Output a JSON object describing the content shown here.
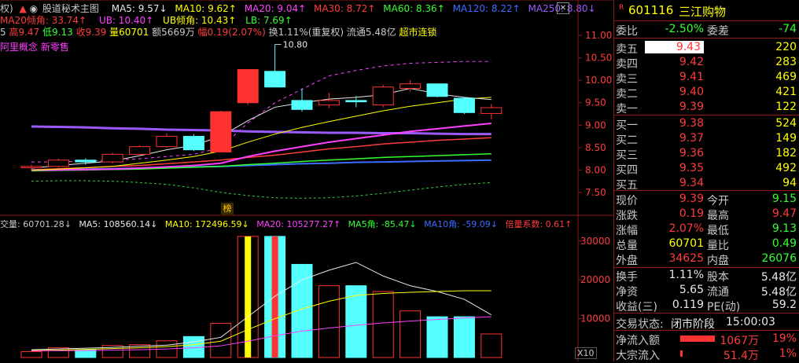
{
  "top_bar": {
    "left_label": "权)",
    "title": "股道秘术主图",
    "ma5": "MA5: 9.57↓",
    "ma10": "MA10: 9.62↑",
    "ma20": "MA20: 9.04↑",
    "ma30": "MA30: 8.72↑",
    "ma60": "MA60: 8.36↑",
    "ma120": "MA120: 8.22↑",
    "ma250": "MA250: 8.80↓"
  },
  "line2": {
    "ma20_angle": "MA20倾角: 33.74↑",
    "ub": "UB: 10.40↑",
    "ub_angle": "UB倾角: 10.43↑",
    "lb": "LB: 7.69↑"
  },
  "line3": {
    "prefix": "5",
    "high": "高9.47",
    "low": "低9.13",
    "close": "收9.39",
    "volume": "量60701",
    "amount": "额5669万",
    "amp": "幅0.19(2.07%)",
    "turnover": "换1.11%(重复权)",
    "float": "流通5.48亿",
    "tag": "超市连锁"
  },
  "concept": "阿里概念 新零售",
  "price_axis": [
    "11.00",
    "10.50",
    "10.00",
    "9.50",
    "9.00",
    "8.50",
    "8.00",
    "7.50"
  ],
  "high_marker": "10.80",
  "bang_label": "榜",
  "vol_bar": {
    "vol": "交量: 60701.28↓",
    "ma5": "MA5: 108560.14↓",
    "ma10": "MA10: 172496.59↓",
    "ma20": "MA20: 105277.27↑",
    "ma5_angle": "MA5角: -85.47↓",
    "ma10_angle": "MA10角: -59.09↓",
    "ratio": "倍量系数: 0.61↑"
  },
  "vol_axis": [
    "30000",
    "20000",
    "10000"
  ],
  "x10": "X10",
  "colors": {
    "up": "#ff3232",
    "down": "#54ffff",
    "ma5": "#e8e8e8",
    "ma10": "#ffff00",
    "ma20": "#ff40ff",
    "ma250": "#9b5bff",
    "border": "#8b1a1a"
  },
  "chart_data": {
    "type": "candlestick",
    "candles": [
      {
        "o": 8.05,
        "h": 8.12,
        "l": 7.98,
        "c": 8.08
      },
      {
        "o": 8.08,
        "h": 8.25,
        "l": 8.06,
        "c": 8.22
      },
      {
        "o": 8.22,
        "h": 8.26,
        "l": 8.12,
        "c": 8.18
      },
      {
        "o": 8.18,
        "h": 8.38,
        "l": 8.15,
        "c": 8.35
      },
      {
        "o": 8.35,
        "h": 8.55,
        "l": 8.32,
        "c": 8.52
      },
      {
        "o": 8.52,
        "h": 8.82,
        "l": 8.5,
        "c": 8.75
      },
      {
        "o": 8.75,
        "h": 8.8,
        "l": 8.42,
        "c": 8.45
      },
      {
        "o": 8.4,
        "h": 9.32,
        "l": 8.4,
        "c": 9.3
      },
      {
        "o": 9.5,
        "h": 10.25,
        "l": 9.45,
        "c": 10.24
      },
      {
        "o": 10.2,
        "h": 10.8,
        "l": 9.85,
        "c": 9.85
      },
      {
        "o": 9.55,
        "h": 9.82,
        "l": 9.3,
        "c": 9.35
      },
      {
        "o": 9.45,
        "h": 9.72,
        "l": 9.38,
        "c": 9.55
      },
      {
        "o": 9.55,
        "h": 9.65,
        "l": 9.4,
        "c": 9.52
      },
      {
        "o": 9.45,
        "h": 9.9,
        "l": 9.4,
        "c": 9.85
      },
      {
        "o": 9.82,
        "h": 10.0,
        "l": 9.75,
        "c": 9.92
      },
      {
        "o": 9.92,
        "h": 9.92,
        "l": 9.62,
        "c": 9.64
      },
      {
        "o": 9.6,
        "h": 9.63,
        "l": 9.25,
        "c": 9.28
      },
      {
        "o": 9.26,
        "h": 9.47,
        "l": 9.13,
        "c": 9.39
      }
    ],
    "volumes": [
      1500,
      2500,
      2000,
      3100,
      3300,
      4300,
      5400,
      8800,
      31200,
      31200,
      24000,
      18500,
      18500,
      17000,
      12000,
      10500,
      10500,
      6070
    ],
    "y_range": [
      7.2,
      11.3
    ],
    "vol_range": [
      0,
      33000
    ],
    "ma5": [
      8.04,
      8.1,
      8.15,
      8.2,
      8.32,
      8.45,
      8.55,
      8.75,
      9.1,
      9.4,
      9.5,
      9.58,
      9.62,
      9.68,
      9.82,
      9.7,
      9.62,
      9.57
    ],
    "ma10": [
      8.0,
      8.02,
      8.05,
      8.08,
      8.15,
      8.22,
      8.3,
      8.42,
      8.62,
      8.8,
      8.95,
      9.08,
      9.2,
      9.32,
      9.42,
      9.5,
      9.58,
      9.62
    ],
    "ma20": [
      8.0,
      8.0,
      8.01,
      8.02,
      8.04,
      8.07,
      8.1,
      8.15,
      8.3,
      8.42,
      8.52,
      8.62,
      8.7,
      8.78,
      8.86,
      8.92,
      8.98,
      9.04
    ],
    "ub_band": [
      8.18,
      8.18,
      8.2,
      8.22,
      8.25,
      8.3,
      8.35,
      8.5,
      9.05,
      9.5,
      9.8,
      10.1,
      10.22,
      10.32,
      10.38,
      10.4,
      10.42,
      10.42
    ],
    "lb_band": [
      7.75,
      7.76,
      7.76,
      7.75,
      7.72,
      7.68,
      7.6,
      7.5,
      7.43,
      7.38,
      7.37,
      7.38,
      7.42,
      7.48,
      7.55,
      7.62,
      7.68,
      7.72
    ],
    "ma250": [
      8.97,
      8.96,
      8.95,
      8.93,
      8.92,
      8.9,
      8.89,
      8.88,
      8.86,
      8.85,
      8.84,
      8.83,
      8.83,
      8.82,
      8.82,
      8.81,
      8.8,
      8.8
    ],
    "ma30": [
      8.0,
      8.03,
      8.05,
      8.08,
      8.1,
      8.14,
      8.18,
      8.22,
      8.28,
      8.33,
      8.4,
      8.47,
      8.52,
      8.58,
      8.62,
      8.66,
      8.69,
      8.72
    ],
    "ma60": [
      7.98,
      7.99,
      8.0,
      8.01,
      8.02,
      8.04,
      8.06,
      8.08,
      8.12,
      8.15,
      8.19,
      8.22,
      8.25,
      8.28,
      8.3,
      8.32,
      8.34,
      8.36
    ],
    "ma120": [
      8.0,
      8.01,
      8.02,
      8.03,
      8.04,
      8.05,
      8.07,
      8.08,
      8.1,
      8.12,
      8.14,
      8.15,
      8.17,
      8.18,
      8.19,
      8.2,
      8.21,
      8.22
    ],
    "vol_ma5": [
      2000,
      2200,
      2400,
      2600,
      2900,
      3200,
      4000,
      5200,
      10500,
      15800,
      20000,
      22500,
      24500,
      21000,
      18500,
      17000,
      15000,
      11000
    ],
    "vol_ma10": [
      1800,
      1900,
      2100,
      2300,
      2500,
      2800,
      3300,
      4200,
      7200,
      10000,
      12500,
      14500,
      16000,
      16500,
      16800,
      17000,
      17200,
      17200
    ],
    "vol_ma20": [
      1700,
      1750,
      1800,
      1900,
      2000,
      2200,
      2500,
      3000,
      4200,
      5600,
      6800,
      7600,
      8300,
      8900,
      9400,
      9800,
      10200,
      10500
    ]
  },
  "side": {
    "code": "601116",
    "name": "三江购物",
    "r_mark": "R",
    "weibi_label": "委比",
    "weibi": "-2.50%",
    "weicha_label": "委差",
    "weicha": "-74",
    "asks": [
      {
        "label": "卖五",
        "price": "9.43",
        "vol": "220"
      },
      {
        "label": "卖四",
        "price": "9.42",
        "vol": "283"
      },
      {
        "label": "卖三",
        "price": "9.41",
        "vol": "469"
      },
      {
        "label": "卖二",
        "price": "9.40",
        "vol": "421"
      },
      {
        "label": "卖一",
        "price": "9.39",
        "vol": "122"
      }
    ],
    "bids": [
      {
        "label": "买一",
        "price": "9.38",
        "vol": "524"
      },
      {
        "label": "买二",
        "price": "9.37",
        "vol": "149"
      },
      {
        "label": "买三",
        "price": "9.36",
        "vol": "182"
      },
      {
        "label": "买四",
        "price": "9.35",
        "vol": "492"
      },
      {
        "label": "买五",
        "price": "9.34",
        "vol": "94"
      }
    ],
    "quote": [
      {
        "l1": "现价",
        "v1": "9.39",
        "l2": "今开",
        "v2": "9.15",
        "c1": "red",
        "c2": "green"
      },
      {
        "l1": "涨跌",
        "v1": "0.19",
        "l2": "最高",
        "v2": "9.47",
        "c1": "red",
        "c2": "red"
      },
      {
        "l1": "涨幅",
        "v1": "2.07%",
        "l2": "最低",
        "v2": "9.13",
        "c1": "red",
        "c2": "green"
      },
      {
        "l1": "总量",
        "v1": "60701",
        "l2": "量比",
        "v2": "0.49",
        "c1": "yellow",
        "c2": "green"
      },
      {
        "l1": "外盘",
        "v1": "34625",
        "l2": "内盘",
        "v2": "26076",
        "c1": "red",
        "c2": "green"
      }
    ],
    "fund": [
      {
        "l1": "换手",
        "v1": "1.11%",
        "l2": "股本",
        "v2": "5.48亿"
      },
      {
        "l1": "净资",
        "v1": "5.65",
        "l2": "流通",
        "v2": "5.48亿"
      },
      {
        "l1": "收益(三)",
        "v1": "0.119",
        "l2": "PE(动)",
        "v2": "59.2"
      }
    ],
    "trade_state_label": "交易状态:",
    "trade_state": "闭市阶段",
    "trade_time": "15:00:03",
    "netflow_label": "净流入额",
    "netflow_value": "1067万",
    "netflow_pct": "19%",
    "block_label": "大宗流入",
    "block_value": "51.4万",
    "block_pct": "1%"
  }
}
